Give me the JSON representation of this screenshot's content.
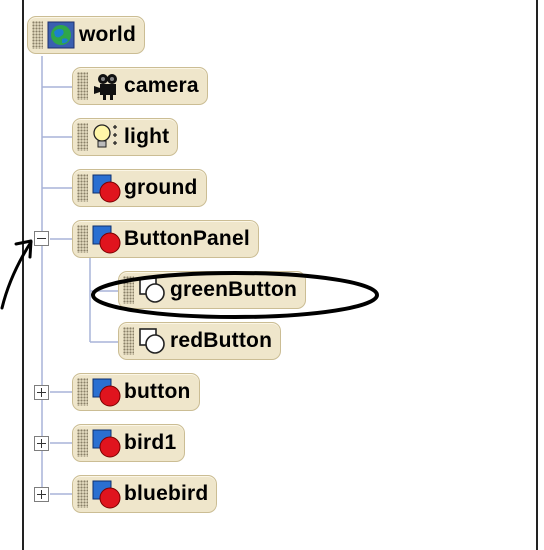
{
  "tree": {
    "nodes": [
      {
        "id": "world",
        "label": "world",
        "icon": "globe-icon"
      },
      {
        "id": "camera",
        "label": "camera",
        "icon": "camera-icon"
      },
      {
        "id": "light",
        "label": "light",
        "icon": "lightbulb-icon"
      },
      {
        "id": "ground",
        "label": "ground",
        "icon": "object-icon"
      },
      {
        "id": "buttonpanel",
        "label": "ButtonPanel",
        "icon": "object-icon",
        "expanded": true
      },
      {
        "id": "greenbutton",
        "label": "greenButton",
        "icon": "part-icon",
        "selected": true
      },
      {
        "id": "redbutton",
        "label": "redButton",
        "icon": "part-icon"
      },
      {
        "id": "button",
        "label": "button",
        "icon": "object-icon",
        "expanded": false
      },
      {
        "id": "bird1",
        "label": "bird1",
        "icon": "object-icon",
        "expanded": false
      },
      {
        "id": "bluebird",
        "label": "bluebird",
        "icon": "object-icon",
        "expanded": false
      }
    ]
  },
  "colors": {
    "node_fill": "#efe6cb",
    "node_border": "#cbbd94",
    "tree_line": "#a9b4d8",
    "object_red": "#e0141e",
    "object_blue": "#2a6fd1",
    "annotation": "#000000"
  }
}
